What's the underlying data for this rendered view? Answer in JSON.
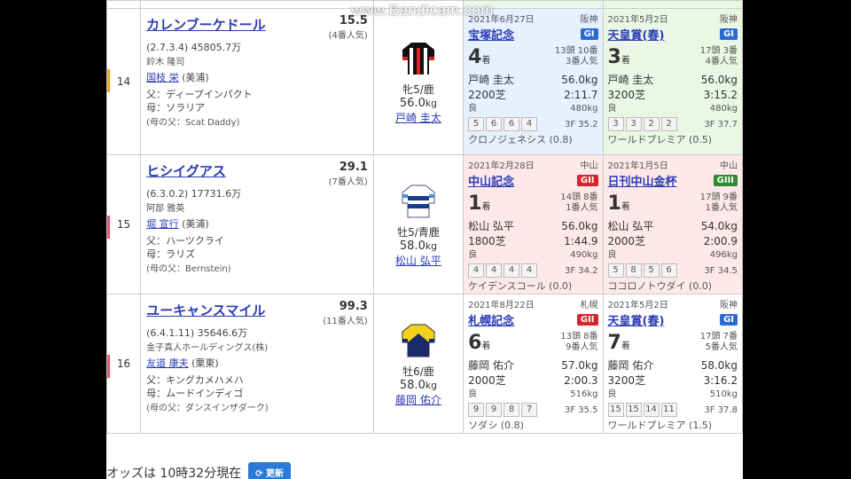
{
  "watermark": "www.Bandicam.com",
  "horses": [
    {
      "no": "14",
      "bar_color": "#f0a028",
      "name": "カレンブーケドール",
      "odds": "15.5",
      "popularity": "(4番人気)",
      "record": "(2.7.3.4)",
      "earnings": "45805.7万",
      "owner": "鈴木 隆司",
      "trainer": "国枝 栄",
      "trainer_loc": "(美浦)",
      "sire": "父：ディープインパクト",
      "dam": "母：ソラリア",
      "damsire": "(母の父：Scat Daddy)",
      "sex_age": "牝5/鹿",
      "weight": "56.0",
      "weight_unit": "kg",
      "jockey": "戸崎 圭太",
      "silk": "black",
      "races": [
        {
          "date": "2021年6月27日",
          "venue": "阪神",
          "name": "宝塚記念",
          "grade": "GI",
          "grade_class": "gi",
          "bg": "g1",
          "rank": "4",
          "rank_unit": "着",
          "heads": "13頭 10番",
          "pop": "3番人気",
          "jockey": "戸崎 圭太",
          "kg": "56.0kg",
          "dist": "2200芝",
          "time": "2:11.7",
          "cond": "良",
          "bw": "480kg",
          "corners": [
            "5",
            "6",
            "6",
            "4"
          ],
          "f3": "3F 35.2",
          "winner": "クロノジェネシス (0.8)"
        },
        {
          "date": "2021年5月2日",
          "venue": "阪神",
          "name": "天皇賞(春)",
          "grade": "GI",
          "grade_class": "gi",
          "bg": "g3",
          "rank": "3",
          "rank_unit": "着",
          "heads": "17頭 3番",
          "pop": "4番人気",
          "jockey": "戸崎 圭太",
          "kg": "56.0kg",
          "dist": "3200芝",
          "time": "3:15.2",
          "cond": "良",
          "bw": "480kg",
          "corners": [
            "3",
            "3",
            "2",
            "2"
          ],
          "f3": "3F 37.7",
          "winner": "ワールドプレミア (0.5)"
        }
      ]
    },
    {
      "no": "15",
      "bar_color": "#e05a6a",
      "name": "ヒシイグアス",
      "odds": "29.1",
      "popularity": "(7番人気)",
      "record": "(6.3.0.2)",
      "earnings": "17731.6万",
      "owner": "阿部 雅英",
      "trainer": "堀 宣行",
      "trainer_loc": "(美浦)",
      "sire": "父：ハーツクライ",
      "dam": "母：ラリズ",
      "damsire": "(母の父：Bernstein)",
      "sex_age": "牡5/青鹿",
      "weight": "58.0",
      "weight_unit": "kg",
      "jockey": "松山 弘平",
      "silk": "white",
      "races": [
        {
          "date": "2021年2月28日",
          "venue": "中山",
          "name": "中山記念",
          "grade": "GII",
          "grade_class": "gii",
          "bg": "g2",
          "rank": "1",
          "rank_unit": "着",
          "heads": "14頭 8番",
          "pop": "1番人気",
          "jockey": "松山 弘平",
          "kg": "56.0kg",
          "dist": "1800芝",
          "time": "1:44.9",
          "cond": "良",
          "bw": "490kg",
          "corners": [
            "4",
            "4",
            "4",
            "4"
          ],
          "f3": "3F 34.2",
          "winner": "ケイデンスコール (0.0)"
        },
        {
          "date": "2021年1月5日",
          "venue": "中山",
          "name": "日刊中山金杯",
          "grade": "GIII",
          "grade_class": "giii",
          "bg": "g2",
          "rank": "1",
          "rank_unit": "着",
          "heads": "17頭 9番",
          "pop": "1番人気",
          "jockey": "松山 弘平",
          "kg": "54.0kg",
          "dist": "2000芝",
          "time": "2:00.9",
          "cond": "良",
          "bw": "496kg",
          "corners": [
            "5",
            "8",
            "5",
            "6"
          ],
          "f3": "3F 34.5",
          "winner": "ココロノトウダイ (0.0)"
        }
      ]
    },
    {
      "no": "16",
      "bar_color": "#e05a6a",
      "name": "ユーキャンスマイル",
      "odds": "99.3",
      "popularity": "(11番人気)",
      "record": "(6.4.1.11)",
      "earnings": "35646.6万",
      "owner": "金子真人ホールディングス(株)",
      "trainer": "友道 康夫",
      "trainer_loc": "(栗東)",
      "sire": "父：キングカメハメハ",
      "dam": "母：ムードインディゴ",
      "damsire": "(母の父：ダンスインザダーク)",
      "sex_age": "牡6/鹿",
      "weight": "58.0",
      "weight_unit": "kg",
      "jockey": "藤岡 佑介",
      "silk": "yellow",
      "races": [
        {
          "date": "2021年8月22日",
          "venue": "札幌",
          "name": "札幌記念",
          "grade": "GII",
          "grade_class": "gii",
          "bg": "",
          "rank": "6",
          "rank_unit": "着",
          "heads": "13頭 8番",
          "pop": "9番人気",
          "jockey": "藤岡 佑介",
          "kg": "57.0kg",
          "dist": "2000芝",
          "time": "2:00.3",
          "cond": "良",
          "bw": "516kg",
          "corners": [
            "9",
            "9",
            "8",
            "7"
          ],
          "f3": "3F 35.5",
          "winner": "ソダシ (0.8)"
        },
        {
          "date": "2021年5月2日",
          "venue": "阪神",
          "name": "天皇賞(春)",
          "grade": "GI",
          "grade_class": "gi",
          "bg": "",
          "rank": "7",
          "rank_unit": "着",
          "heads": "17頭 7番",
          "pop": "5番人気",
          "jockey": "藤岡 佑介",
          "kg": "58.0kg",
          "dist": "3200芝",
          "time": "3:16.2",
          "cond": "良",
          "bw": "510kg",
          "corners": [
            "15",
            "15",
            "14",
            "11"
          ],
          "f3": "3F 37.8",
          "winner": "ワールドプレミア (1.5)"
        }
      ]
    }
  ],
  "footer": {
    "odds_text": "オッズは 10時32分現在",
    "refresh_label": "更新",
    "refresh_icon": "refresh-icon"
  }
}
